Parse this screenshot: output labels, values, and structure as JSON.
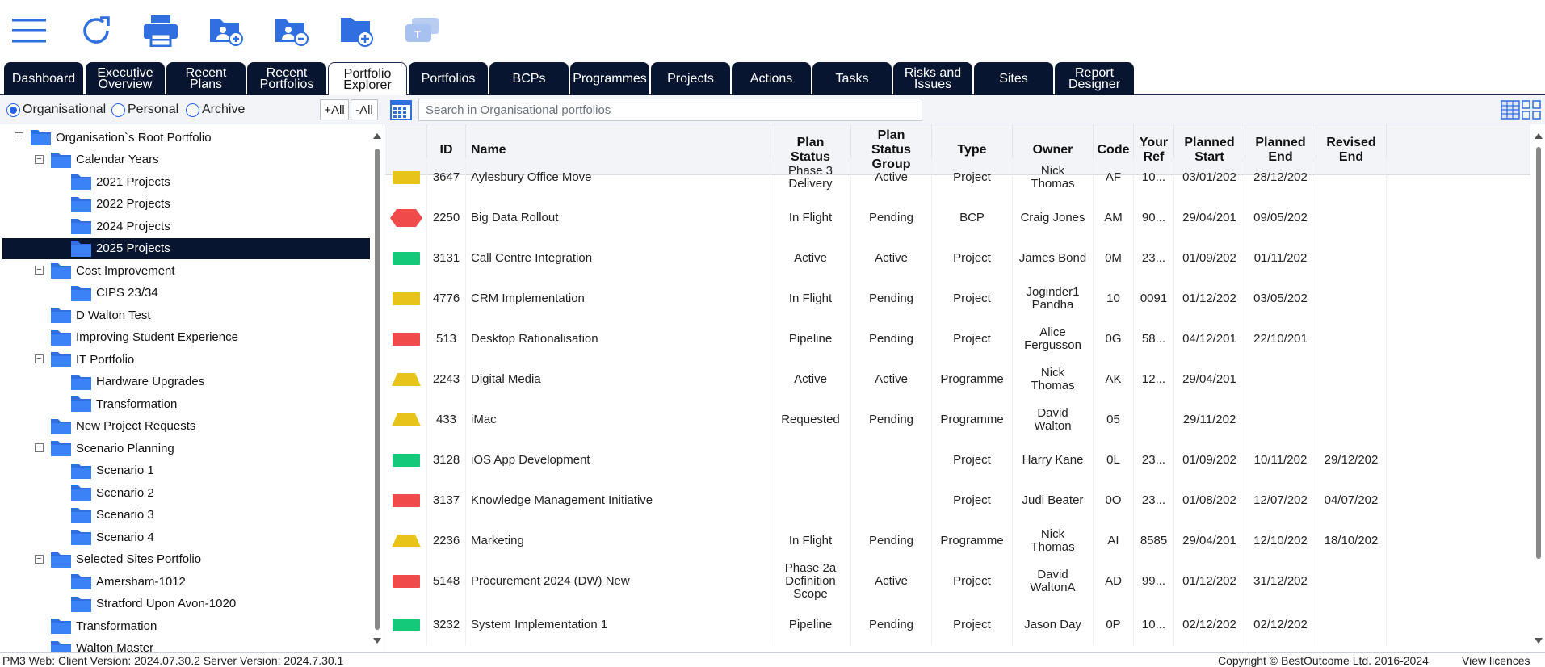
{
  "toolbar": {
    "icons": [
      "menu-icon",
      "refresh-icon",
      "print-icon",
      "folder-add-user-icon",
      "folder-remove-user-icon",
      "folder-add-icon",
      "chat-icon"
    ]
  },
  "tabs": [
    {
      "label": "Dashboard",
      "active": false
    },
    {
      "label": "Executive\nOverview",
      "active": false
    },
    {
      "label": "Recent Plans",
      "active": false
    },
    {
      "label": "Recent\nPortfolios",
      "active": false
    },
    {
      "label": "Portfolio\nExplorer",
      "active": true
    },
    {
      "label": "Portfolios",
      "active": false
    },
    {
      "label": "BCPs",
      "active": false
    },
    {
      "label": "Programmes",
      "active": false
    },
    {
      "label": "Projects",
      "active": false
    },
    {
      "label": "Actions",
      "active": false
    },
    {
      "label": "Tasks",
      "active": false
    },
    {
      "label": "Risks and\nIssues",
      "active": false
    },
    {
      "label": "Sites",
      "active": false
    },
    {
      "label": "Report\nDesigner",
      "active": false
    }
  ],
  "filter": {
    "radios": [
      {
        "label": "Organisational",
        "checked": true
      },
      {
        "label": "Personal",
        "checked": false
      },
      {
        "label": "Archive",
        "checked": false
      }
    ],
    "plus_all": "+All",
    "minus_all": "-All",
    "search_placeholder": "Search in Organisational portfolios"
  },
  "tree": [
    {
      "label": "Organisation`s Root Portfolio",
      "level": 0,
      "toggle": "−"
    },
    {
      "label": "Calendar Years",
      "level": 1,
      "toggle": "−"
    },
    {
      "label": "2021 Projects",
      "level": 2,
      "toggle": ""
    },
    {
      "label": "2022 Projects",
      "level": 2,
      "toggle": ""
    },
    {
      "label": "2024 Projects",
      "level": 2,
      "toggle": ""
    },
    {
      "label": "2025 Projects",
      "level": 2,
      "toggle": "",
      "selected": true
    },
    {
      "label": "Cost Improvement",
      "level": 1,
      "toggle": "−"
    },
    {
      "label": "CIPS 23/34",
      "level": 2,
      "toggle": ""
    },
    {
      "label": "D Walton Test",
      "level": 1,
      "toggle": ""
    },
    {
      "label": "Improving Student Experience",
      "level": 1,
      "toggle": ""
    },
    {
      "label": "IT Portfolio",
      "level": 1,
      "toggle": "−"
    },
    {
      "label": "Hardware Upgrades",
      "level": 2,
      "toggle": ""
    },
    {
      "label": "Transformation",
      "level": 2,
      "toggle": ""
    },
    {
      "label": "New Project Requests",
      "level": 1,
      "toggle": ""
    },
    {
      "label": "Scenario Planning",
      "level": 1,
      "toggle": "−"
    },
    {
      "label": "Scenario 1",
      "level": 2,
      "toggle": ""
    },
    {
      "label": "Scenario 2",
      "level": 2,
      "toggle": ""
    },
    {
      "label": "Scenario 3",
      "level": 2,
      "toggle": ""
    },
    {
      "label": "Scenario 4",
      "level": 2,
      "toggle": ""
    },
    {
      "label": "Selected Sites Portfolio",
      "level": 1,
      "toggle": "−"
    },
    {
      "label": "Amersham-1012",
      "level": 2,
      "toggle": ""
    },
    {
      "label": "Stratford Upon Avon-1020",
      "level": 2,
      "toggle": ""
    },
    {
      "label": "Transformation",
      "level": 1,
      "toggle": ""
    },
    {
      "label": "Walton Master",
      "level": 1,
      "toggle": ""
    }
  ],
  "columns": [
    "",
    "ID",
    "Name",
    "Plan\nStatus",
    "Plan\nStatus\nGroup",
    "Type",
    "Owner",
    "Code",
    "Your\nRef",
    "Planned\nStart",
    "Planned\nEnd",
    "Revised\nEnd"
  ],
  "rows": [
    {
      "rag": "yellow-rect",
      "id": "3647",
      "name": "Aylesbury Office Move",
      "plan_status": "Phase 3\nDelivery",
      "group": "Active",
      "type": "Project",
      "owner": "Nick\nThomas",
      "code": "AF",
      "ref": "10...",
      "pstart": "03/01/202",
      "pend": "28/12/202",
      "rend": ""
    },
    {
      "rag": "red-hex",
      "id": "2250",
      "name": "Big Data Rollout",
      "plan_status": "In Flight",
      "group": "Pending",
      "type": "BCP",
      "owner": "Craig Jones",
      "code": "AM",
      "ref": "90...",
      "pstart": "29/04/201",
      "pend": "09/05/202",
      "rend": ""
    },
    {
      "rag": "green-rect",
      "id": "3131",
      "name": "Call Centre Integration",
      "plan_status": "Active",
      "group": "Active",
      "type": "Project",
      "owner": "James Bond",
      "code": "0M",
      "ref": "23...",
      "pstart": "01/09/202",
      "pend": "01/11/202",
      "rend": ""
    },
    {
      "rag": "yellow-rect",
      "id": "4776",
      "name": "CRM Implementation",
      "plan_status": "In Flight",
      "group": "Pending",
      "type": "Project",
      "owner": "Joginder1\nPandha",
      "code": "10",
      "ref": "0091",
      "pstart": "01/12/202",
      "pend": "03/05/202",
      "rend": ""
    },
    {
      "rag": "red-rect",
      "id": "513",
      "name": "Desktop Rationalisation",
      "plan_status": "Pipeline",
      "group": "Pending",
      "type": "Project",
      "owner": "Alice\nFergusson",
      "code": "0G",
      "ref": "58...",
      "pstart": "04/12/201",
      "pend": "22/10/201",
      "rend": ""
    },
    {
      "rag": "yellow-trap",
      "id": "2243",
      "name": "Digital Media",
      "plan_status": "Active",
      "group": "Active",
      "type": "Programme",
      "owner": "Nick\nThomas",
      "code": "AK",
      "ref": "12...",
      "pstart": "29/04/201",
      "pend": "",
      "rend": ""
    },
    {
      "rag": "yellow-trap",
      "id": "433",
      "name": "iMac",
      "plan_status": "Requested",
      "group": "Pending",
      "type": "Programme",
      "owner": "David\nWalton",
      "code": "05",
      "ref": "",
      "pstart": "29/11/202",
      "pend": "",
      "rend": ""
    },
    {
      "rag": "green-rect",
      "id": "3128",
      "name": "iOS App Development",
      "plan_status": "",
      "group": "",
      "type": "Project",
      "owner": "Harry Kane",
      "code": "0L",
      "ref": "23...",
      "pstart": "01/09/202",
      "pend": "10/11/202",
      "rend": "29/12/202"
    },
    {
      "rag": "red-rect",
      "id": "3137",
      "name": "Knowledge Management Initiative",
      "plan_status": "",
      "group": "",
      "type": "Project",
      "owner": "Judi Beater",
      "code": "0O",
      "ref": "23...",
      "pstart": "01/08/202",
      "pend": "12/07/202",
      "rend": "04/07/202"
    },
    {
      "rag": "yellow-trap",
      "id": "2236",
      "name": "Marketing",
      "plan_status": "In Flight",
      "group": "Pending",
      "type": "Programme",
      "owner": "Nick\nThomas",
      "code": "AI",
      "ref": "8585",
      "pstart": "29/04/201",
      "pend": "12/10/202",
      "rend": "18/10/202"
    },
    {
      "rag": "red-rect",
      "id": "5148",
      "name": "Procurement 2024 (DW) New",
      "plan_status": "Phase 2a\nDefinition\nScope",
      "group": "Active",
      "type": "Project",
      "owner": "David\nWaltonA",
      "code": "AD",
      "ref": "99...",
      "pstart": "01/12/202",
      "pend": "31/12/202",
      "rend": ""
    },
    {
      "rag": "green-rect",
      "id": "3232",
      "name": "System Implementation 1",
      "plan_status": "Pipeline",
      "group": "Pending",
      "type": "Project",
      "owner": "Jason Day",
      "code": "0P",
      "ref": "10...",
      "pstart": "02/12/202",
      "pend": "02/12/202",
      "rend": ""
    }
  ],
  "rag_colors": {
    "yellow": "#e6c419",
    "red": "#f04a4a",
    "green": "#14c97a"
  },
  "status": {
    "left": "PM3 Web: Client Version: 2024.07.30.2 Server Version: 2024.7.30.1",
    "copyright": "Copyright © BestOutcome Ltd. 2016-2024",
    "licences": "View licences"
  }
}
